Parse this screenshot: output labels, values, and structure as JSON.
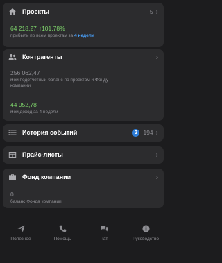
{
  "projects": {
    "title": "Проекты",
    "count": "5",
    "profit": "64 218,27",
    "growth": "↑101,78%",
    "caption": "прибыль по всем проектам за",
    "period": "4 недели",
    "icon": "home-icon"
  },
  "contractors": {
    "title": "Контрагенты",
    "balance": "256 062,47",
    "balance_caption": "мой подотчетный баланс по проектам и Фонду компании",
    "income": "44 952,78",
    "income_caption": "мой доход за 4 недели",
    "icon": "users-icon"
  },
  "history": {
    "title": "История событий",
    "badge": "2",
    "count": "194",
    "icon": "list-icon"
  },
  "price_lists": {
    "title": "Прайс-листы",
    "icon": "table-icon"
  },
  "fund": {
    "title": "Фонд компании",
    "balance": "0",
    "caption": "баланс Фонда компании",
    "icon": "briefcase-icon"
  },
  "tabs": [
    {
      "label": "Полезное",
      "icon": "send-icon"
    },
    {
      "label": "Помощь",
      "icon": "phone-icon"
    },
    {
      "label": "Чат",
      "icon": "chat-icon"
    },
    {
      "label": "Руководство",
      "icon": "info-icon"
    }
  ],
  "colors": {
    "background": "#1c1c1e",
    "card": "#2c2c2e",
    "green": "#7ed36b",
    "link": "#4aa3ff",
    "badge": "#2f7ed8"
  }
}
